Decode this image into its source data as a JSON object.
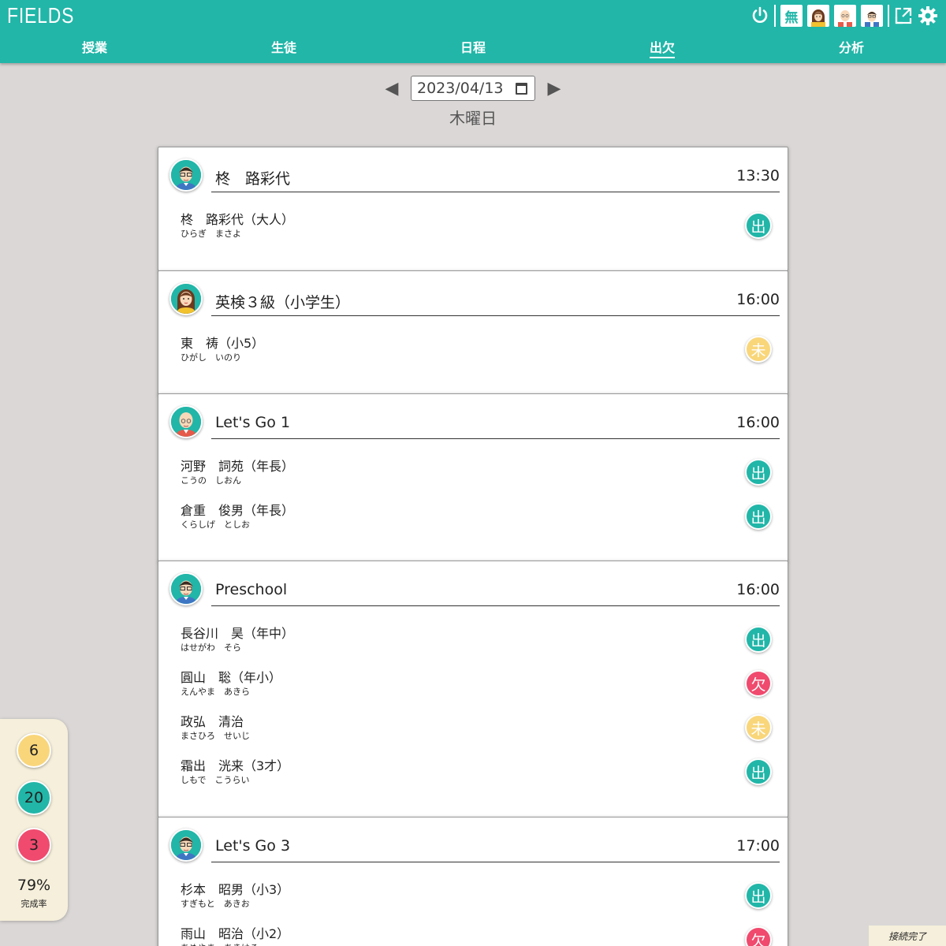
{
  "header": {
    "logo": "FIELDS",
    "muhen_label": "無",
    "nav": [
      {
        "label": "授業",
        "active": false
      },
      {
        "label": "生徒",
        "active": false
      },
      {
        "label": "日程",
        "active": false
      },
      {
        "label": "出欠",
        "active": true
      },
      {
        "label": "分析",
        "active": false
      }
    ],
    "icons": [
      "power-icon",
      "free-badge",
      "teacher-female-avatar",
      "teacher-bald-avatar",
      "teacher-glasses-avatar",
      "expand-icon",
      "gear-icon"
    ]
  },
  "date_nav": {
    "prev_icon": "◀",
    "next_icon": "▶",
    "date": "2023/04/13",
    "weekday": "木曜日"
  },
  "status_colors": {
    "present": "#21b6a8",
    "absent": "#f04a6e",
    "pending": "#f9d67a"
  },
  "classes": [
    {
      "title": "柊　路彩代",
      "time": "13:30",
      "teacher_icon": "teacher-glasses-avatar",
      "students": [
        {
          "name": "柊　路彩代（大人）",
          "kana": "ひらぎ　まさよ",
          "status": "present",
          "badge": "出"
        }
      ]
    },
    {
      "title": "英検３級（小学生）",
      "time": "16:00",
      "teacher_icon": "teacher-female-avatar",
      "students": [
        {
          "name": "東　祷（小5）",
          "kana": "ひがし　いのり",
          "status": "pending",
          "badge": "未"
        }
      ]
    },
    {
      "title": "Let's Go 1",
      "time": "16:00",
      "teacher_icon": "teacher-bald-avatar",
      "students": [
        {
          "name": "河野　詞苑（年長）",
          "kana": "こうの　しおん",
          "status": "present",
          "badge": "出"
        },
        {
          "name": "倉重　俊男（年長）",
          "kana": "くらしげ　としお",
          "status": "present",
          "badge": "出"
        }
      ]
    },
    {
      "title": "Preschool",
      "time": "16:00",
      "teacher_icon": "teacher-glasses-avatar",
      "students": [
        {
          "name": "長谷川　昊（年中）",
          "kana": "はせがわ　そら",
          "status": "present",
          "badge": "出"
        },
        {
          "name": "圓山　聡（年小）",
          "kana": "えんやま　あきら",
          "status": "absent",
          "badge": "欠"
        },
        {
          "name": "政弘　清治",
          "kana": "まさひろ　せいじ",
          "status": "pending",
          "badge": "未"
        },
        {
          "name": "霜出　洸来（3才）",
          "kana": "しもで　こうらい",
          "status": "present",
          "badge": "出"
        }
      ]
    },
    {
      "title": "Let's Go 3",
      "time": "17:00",
      "teacher_icon": "teacher-glasses-avatar",
      "students": [
        {
          "name": "杉本　昭男（小3）",
          "kana": "すぎもと　あきお",
          "status": "present",
          "badge": "出"
        },
        {
          "name": "雨山　昭治（小2）",
          "kana": "あめやま　あきはる",
          "status": "absent",
          "badge": "欠"
        }
      ]
    }
  ],
  "stats": {
    "pending": "6",
    "present": "20",
    "absent": "3",
    "rate": "79%",
    "rate_label": "完成率"
  },
  "connection_status": "接続完了"
}
